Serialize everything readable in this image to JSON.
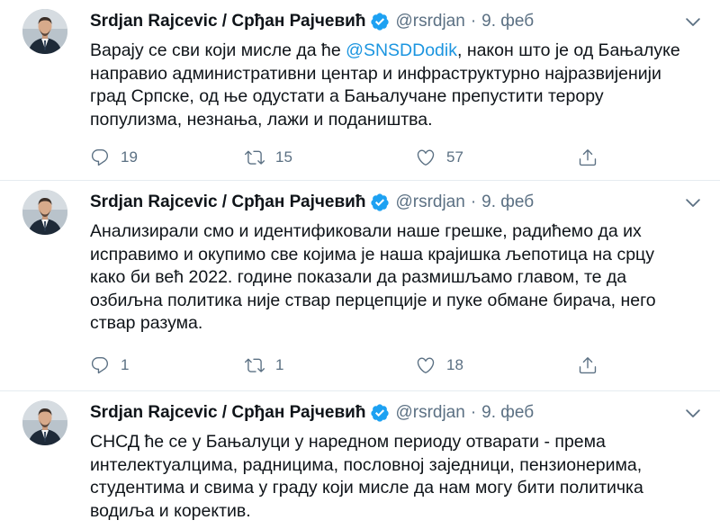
{
  "tweets": [
    {
      "author": {
        "name": "Srdjan Rajcevic / Срђан Рајчевић",
        "handle": "@rsrdjan",
        "verified_icon": "verified-badge-icon"
      },
      "date": "9. феб",
      "separator": "·",
      "text_before": "Варају се сви који мисле да ће ",
      "mention": "@SNSDDodik",
      "text_after": ", након што је од Бањалуке направио административни центар и инфраструктурно најразвијенији град Српске, од ње одустати а Бањалучане препустити терору популизма, незнања, лажи и подаништва.",
      "counts": {
        "replies": "19",
        "retweets": "15",
        "likes": "57"
      }
    },
    {
      "author": {
        "name": "Srdjan Rajcevic / Срђан Рајчевић",
        "handle": "@rsrdjan",
        "verified_icon": "verified-badge-icon"
      },
      "date": "9. феб",
      "separator": "·",
      "text": "Анализирали смо и идентификовали наше грешке, радићемо да их исправимо и окупимо све којима је наша крајишка љепотица на срцу како би већ 2022. године показали да размишљамо главом, те да озбиљна политика није ствар перцепције и пуке обмане бирача, него ствар разума.",
      "counts": {
        "replies": "1",
        "retweets": "1",
        "likes": "18"
      }
    },
    {
      "author": {
        "name": "Srdjan Rajcevic / Срђан Рајчевић",
        "handle": "@rsrdjan",
        "verified_icon": "verified-badge-icon"
      },
      "date": "9. феб",
      "separator": "·",
      "text": "СНСД ће се у Бањалуци у наредном периоду отварати - према интелектуалцима, радницима, пословној заједници, пензионерима, студентима и свима у граду који мисле да нам могу бити политичка водиља и коректив."
    }
  ],
  "colors": {
    "accent": "#1da1f2",
    "mention": "#1b95e0",
    "secondary_text": "#5b7083",
    "divider": "#e6ecf0"
  },
  "icons": {
    "reply": "reply-icon",
    "retweet": "retweet-icon",
    "like": "like-icon",
    "share": "share-icon",
    "more": "chevron-down-icon"
  }
}
